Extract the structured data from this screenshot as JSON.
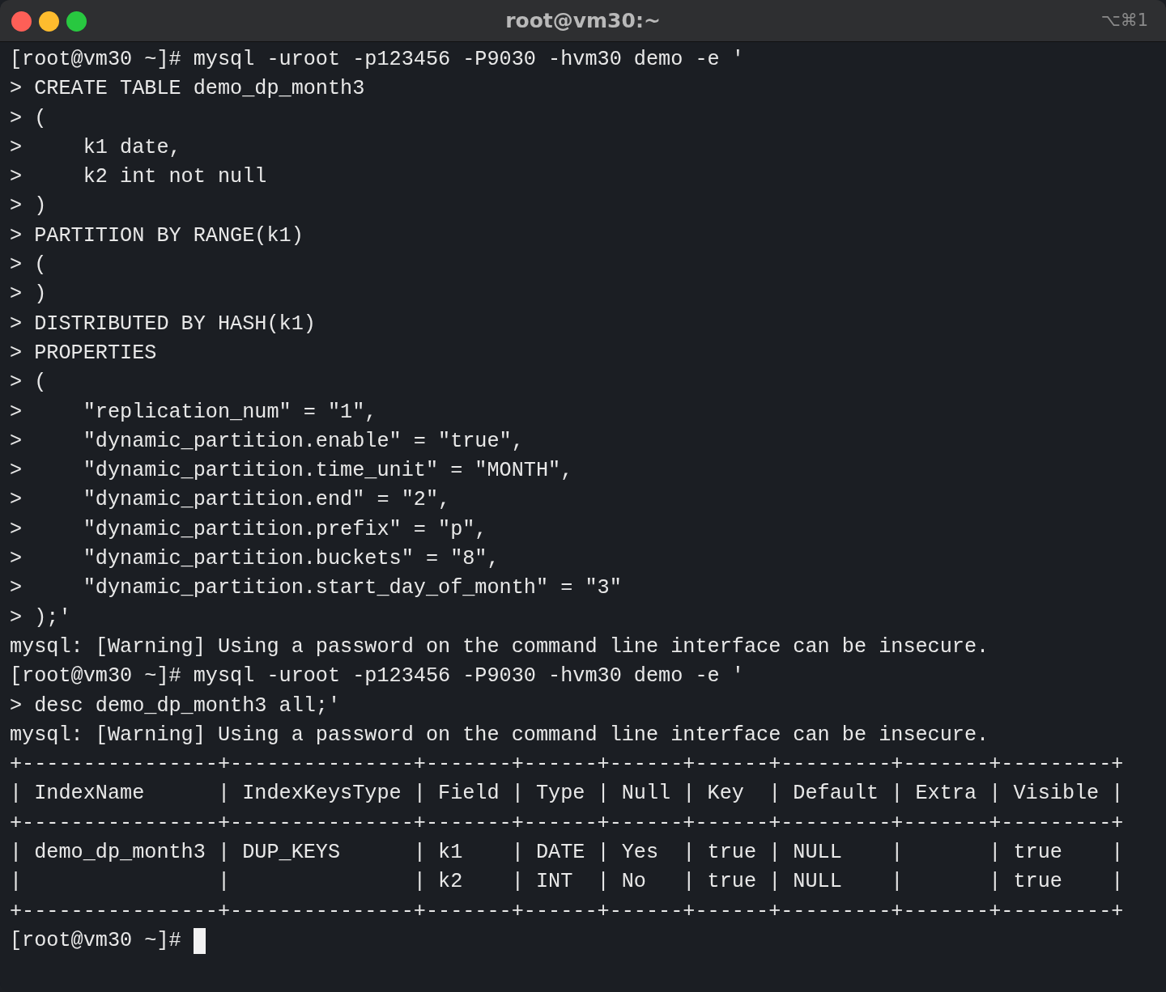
{
  "window": {
    "title": "root@vm30:~",
    "shortcut": "⌥⌘1"
  },
  "lines": [
    "[root@vm30 ~]# mysql -uroot -p123456 -P9030 -hvm30 demo -e '",
    "> CREATE TABLE demo_dp_month3",
    "> (",
    ">     k1 date,",
    ">     k2 int not null",
    "> )",
    "> PARTITION BY RANGE(k1)",
    "> (",
    "> )",
    "> DISTRIBUTED BY HASH(k1)",
    "> PROPERTIES",
    "> (",
    ">     \"replication_num\" = \"1\",",
    ">     \"dynamic_partition.enable\" = \"true\",",
    ">     \"dynamic_partition.time_unit\" = \"MONTH\",",
    ">     \"dynamic_partition.end\" = \"2\",",
    ">     \"dynamic_partition.prefix\" = \"p\",",
    ">     \"dynamic_partition.buckets\" = \"8\",",
    ">     \"dynamic_partition.start_day_of_month\" = \"3\"",
    "> );'",
    "mysql: [Warning] Using a password on the command line interface can be insecure.",
    "[root@vm30 ~]# mysql -uroot -p123456 -P9030 -hvm30 demo -e '",
    "> desc demo_dp_month3 all;'",
    "mysql: [Warning] Using a password on the command line interface can be insecure.",
    "+----------------+---------------+-------+------+------+------+---------+-------+---------+",
    "| IndexName      | IndexKeysType | Field | Type | Null | Key  | Default | Extra | Visible |",
    "+----------------+---------------+-------+------+------+------+---------+-------+---------+",
    "| demo_dp_month3 | DUP_KEYS      | k1    | DATE | Yes  | true | NULL    |       | true    |",
    "|                |               | k2    | INT  | No   | true | NULL    |       | true    |",
    "+----------------+---------------+-------+------+------+------+---------+-------+---------+"
  ],
  "prompt": {
    "text": "[root@vm30 ~]#",
    "cursor": true
  }
}
